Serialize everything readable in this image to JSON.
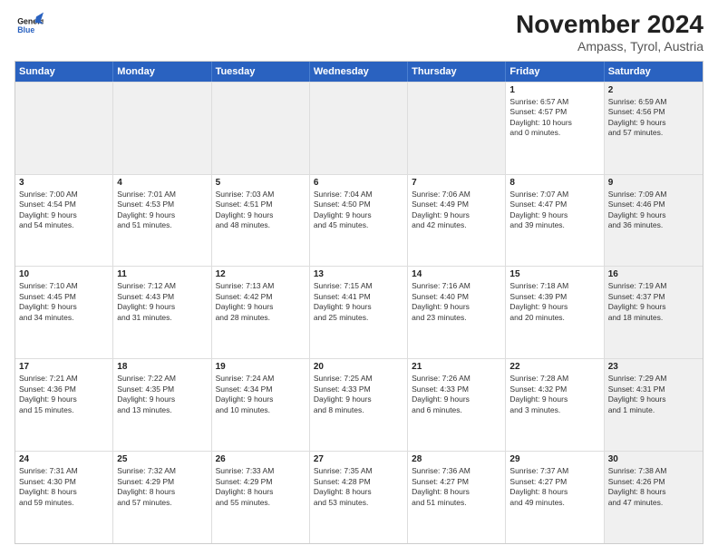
{
  "header": {
    "logo_line1": "General",
    "logo_line2": "Blue",
    "main_title": "November 2024",
    "sub_title": "Ampass, Tyrol, Austria"
  },
  "weekdays": [
    "Sunday",
    "Monday",
    "Tuesday",
    "Wednesday",
    "Thursday",
    "Friday",
    "Saturday"
  ],
  "rows": [
    [
      {
        "day": "",
        "info": "",
        "shaded": true
      },
      {
        "day": "",
        "info": "",
        "shaded": true
      },
      {
        "day": "",
        "info": "",
        "shaded": true
      },
      {
        "day": "",
        "info": "",
        "shaded": true
      },
      {
        "day": "",
        "info": "",
        "shaded": true
      },
      {
        "day": "1",
        "info": "Sunrise: 6:57 AM\nSunset: 4:57 PM\nDaylight: 10 hours\nand 0 minutes.",
        "shaded": false
      },
      {
        "day": "2",
        "info": "Sunrise: 6:59 AM\nSunset: 4:56 PM\nDaylight: 9 hours\nand 57 minutes.",
        "shaded": true
      }
    ],
    [
      {
        "day": "3",
        "info": "Sunrise: 7:00 AM\nSunset: 4:54 PM\nDaylight: 9 hours\nand 54 minutes.",
        "shaded": false
      },
      {
        "day": "4",
        "info": "Sunrise: 7:01 AM\nSunset: 4:53 PM\nDaylight: 9 hours\nand 51 minutes.",
        "shaded": false
      },
      {
        "day": "5",
        "info": "Sunrise: 7:03 AM\nSunset: 4:51 PM\nDaylight: 9 hours\nand 48 minutes.",
        "shaded": false
      },
      {
        "day": "6",
        "info": "Sunrise: 7:04 AM\nSunset: 4:50 PM\nDaylight: 9 hours\nand 45 minutes.",
        "shaded": false
      },
      {
        "day": "7",
        "info": "Sunrise: 7:06 AM\nSunset: 4:49 PM\nDaylight: 9 hours\nand 42 minutes.",
        "shaded": false
      },
      {
        "day": "8",
        "info": "Sunrise: 7:07 AM\nSunset: 4:47 PM\nDaylight: 9 hours\nand 39 minutes.",
        "shaded": false
      },
      {
        "day": "9",
        "info": "Sunrise: 7:09 AM\nSunset: 4:46 PM\nDaylight: 9 hours\nand 36 minutes.",
        "shaded": true
      }
    ],
    [
      {
        "day": "10",
        "info": "Sunrise: 7:10 AM\nSunset: 4:45 PM\nDaylight: 9 hours\nand 34 minutes.",
        "shaded": false
      },
      {
        "day": "11",
        "info": "Sunrise: 7:12 AM\nSunset: 4:43 PM\nDaylight: 9 hours\nand 31 minutes.",
        "shaded": false
      },
      {
        "day": "12",
        "info": "Sunrise: 7:13 AM\nSunset: 4:42 PM\nDaylight: 9 hours\nand 28 minutes.",
        "shaded": false
      },
      {
        "day": "13",
        "info": "Sunrise: 7:15 AM\nSunset: 4:41 PM\nDaylight: 9 hours\nand 25 minutes.",
        "shaded": false
      },
      {
        "day": "14",
        "info": "Sunrise: 7:16 AM\nSunset: 4:40 PM\nDaylight: 9 hours\nand 23 minutes.",
        "shaded": false
      },
      {
        "day": "15",
        "info": "Sunrise: 7:18 AM\nSunset: 4:39 PM\nDaylight: 9 hours\nand 20 minutes.",
        "shaded": false
      },
      {
        "day": "16",
        "info": "Sunrise: 7:19 AM\nSunset: 4:37 PM\nDaylight: 9 hours\nand 18 minutes.",
        "shaded": true
      }
    ],
    [
      {
        "day": "17",
        "info": "Sunrise: 7:21 AM\nSunset: 4:36 PM\nDaylight: 9 hours\nand 15 minutes.",
        "shaded": false
      },
      {
        "day": "18",
        "info": "Sunrise: 7:22 AM\nSunset: 4:35 PM\nDaylight: 9 hours\nand 13 minutes.",
        "shaded": false
      },
      {
        "day": "19",
        "info": "Sunrise: 7:24 AM\nSunset: 4:34 PM\nDaylight: 9 hours\nand 10 minutes.",
        "shaded": false
      },
      {
        "day": "20",
        "info": "Sunrise: 7:25 AM\nSunset: 4:33 PM\nDaylight: 9 hours\nand 8 minutes.",
        "shaded": false
      },
      {
        "day": "21",
        "info": "Sunrise: 7:26 AM\nSunset: 4:33 PM\nDaylight: 9 hours\nand 6 minutes.",
        "shaded": false
      },
      {
        "day": "22",
        "info": "Sunrise: 7:28 AM\nSunset: 4:32 PM\nDaylight: 9 hours\nand 3 minutes.",
        "shaded": false
      },
      {
        "day": "23",
        "info": "Sunrise: 7:29 AM\nSunset: 4:31 PM\nDaylight: 9 hours\nand 1 minute.",
        "shaded": true
      }
    ],
    [
      {
        "day": "24",
        "info": "Sunrise: 7:31 AM\nSunset: 4:30 PM\nDaylight: 8 hours\nand 59 minutes.",
        "shaded": false
      },
      {
        "day": "25",
        "info": "Sunrise: 7:32 AM\nSunset: 4:29 PM\nDaylight: 8 hours\nand 57 minutes.",
        "shaded": false
      },
      {
        "day": "26",
        "info": "Sunrise: 7:33 AM\nSunset: 4:29 PM\nDaylight: 8 hours\nand 55 minutes.",
        "shaded": false
      },
      {
        "day": "27",
        "info": "Sunrise: 7:35 AM\nSunset: 4:28 PM\nDaylight: 8 hours\nand 53 minutes.",
        "shaded": false
      },
      {
        "day": "28",
        "info": "Sunrise: 7:36 AM\nSunset: 4:27 PM\nDaylight: 8 hours\nand 51 minutes.",
        "shaded": false
      },
      {
        "day": "29",
        "info": "Sunrise: 7:37 AM\nSunset: 4:27 PM\nDaylight: 8 hours\nand 49 minutes.",
        "shaded": false
      },
      {
        "day": "30",
        "info": "Sunrise: 7:38 AM\nSunset: 4:26 PM\nDaylight: 8 hours\nand 47 minutes.",
        "shaded": true
      }
    ]
  ]
}
